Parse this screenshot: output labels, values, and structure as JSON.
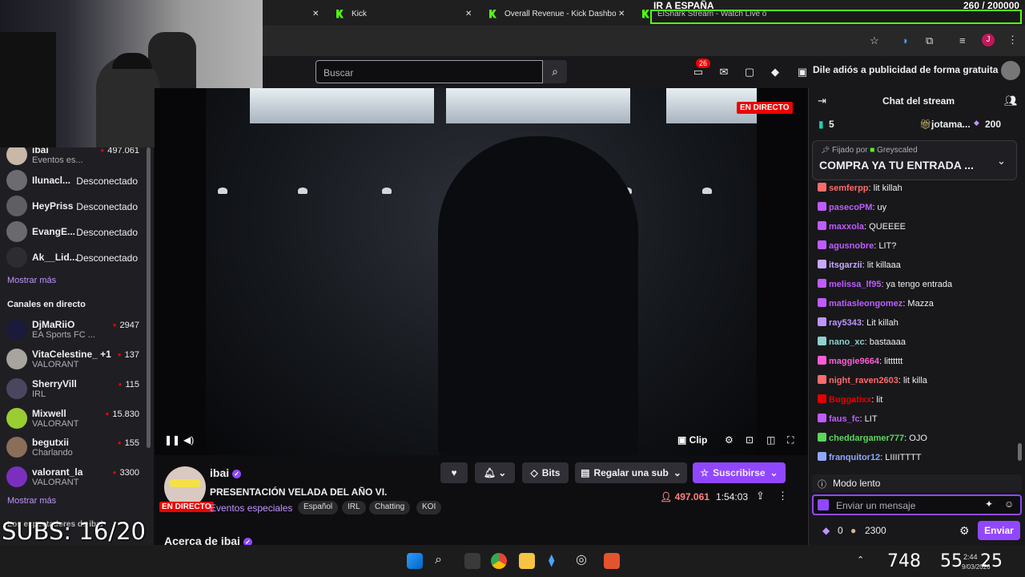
{
  "browser": {
    "tabs": [
      {
        "label": "Kick"
      },
      {
        "label": "Overall Revenue - Kick Dashbo"
      },
      {
        "label": "ElShark Stream - Watch Live o"
      }
    ]
  },
  "overlay": {
    "subs_counter": "SUBS: 16/20",
    "ir_label": "IR A ESPAÑA",
    "goal_counter": "260 / 200000"
  },
  "header": {
    "search_placeholder": "Buscar",
    "notifications_badge": "26",
    "adfree_label": "Dile adiós a publicidad de forma gratuita"
  },
  "sidebar": {
    "followed": [
      {
        "name": "ibai",
        "game": "Eventos es...",
        "count": "497.061"
      },
      {
        "name": "Ilunacl...",
        "status": "Desconectado"
      },
      {
        "name": "HeyPriss",
        "status": "Desconectado"
      },
      {
        "name": "EvangE...",
        "status": "Desconectado"
      },
      {
        "name": "Ak__Lid...",
        "status": "Desconectado"
      }
    ],
    "show_more_1": "Mostrar más",
    "live_heading": "Canales en directo",
    "live": [
      {
        "name": "DjMaRiiO",
        "game": "EA Sports FC ...",
        "count": "2947"
      },
      {
        "name": "VitaCelestine_ +1",
        "game": "VALORANT",
        "count": "137"
      },
      {
        "name": "SherryVill",
        "game": "IRL",
        "count": "115"
      },
      {
        "name": "Mixwell",
        "game": "VALORANT",
        "count": "15.830"
      },
      {
        "name": "begutxii",
        "game": "Charlando",
        "count": "155"
      },
      {
        "name": "valorant_la",
        "game": "VALORANT",
        "count": "3300"
      }
    ],
    "show_more_2": "Mostrar más",
    "bottom_partial": "Los espectadores de ibai"
  },
  "video": {
    "live_tag": "EN DIRECTO",
    "clip_label": "Clip"
  },
  "stream_info": {
    "channel": "ibai",
    "title": "PRESENTACIÓN VELADA DEL AÑO VI.",
    "category": "Eventos especiales",
    "live_tag": "EN DIRECTO",
    "tags": [
      "Español",
      "IRL",
      "Chatting",
      "KOI"
    ],
    "bits_label": "Bits",
    "gift_label": "Regalar una sub",
    "subscribe_label": "Suscribirse",
    "viewers": "497.061",
    "uptime": "1:54:03",
    "about": "Acerca de ibai"
  },
  "chat": {
    "title": "Chat del stream",
    "top_count": "5",
    "top_user": "jotama...",
    "top_user_count": "200",
    "pinned_by": "Fijado por",
    "pinned_by_user": "Greyscaled",
    "pinned_text": "COMPRA YA TU ENTRADA ...",
    "messages": [
      {
        "user": "semferpp",
        "text": ": lit killah",
        "color": "#ff6b6b"
      },
      {
        "user": "pasecoPM",
        "text": ": uy",
        "color": "#bf5cff"
      },
      {
        "user": "maxxola",
        "text": ": QUEEEE",
        "color": "#bf5cff"
      },
      {
        "user": "agusnobre",
        "text": ": LIT?",
        "color": "#bf5cff"
      },
      {
        "user": "itsgarzii",
        "text": ": lit killaaa",
        "color": "#c9a8ff"
      },
      {
        "user": "melissa_lf95",
        "text": ": ya tengo entrada",
        "color": "#bf5cff"
      },
      {
        "user": "matiasleongomez",
        "text": ": Mazza",
        "color": "#bf5cff"
      },
      {
        "user": "ray5343",
        "text": ": Lit killah",
        "color": "#bf94ff"
      },
      {
        "user": "nano_xc",
        "text": ": bastaaaa",
        "color": "#8fd0d0"
      },
      {
        "user": "maggie9664",
        "text": ": litttttt",
        "color": "#ff5cd6"
      },
      {
        "user": "night_raven2603",
        "text": ": lit killa",
        "color": "#ff6b6b"
      },
      {
        "user": "Buggatixx",
        "text": ": lit",
        "color": "#e00000"
      },
      {
        "user": "faus_fc",
        "text": ": LIT",
        "color": "#bf5cff"
      },
      {
        "user": "cheddargamer777",
        "text": ": OJO",
        "color": "#5cd65c"
      },
      {
        "user": "franquitor12",
        "text": ": LIIIITTTT",
        "color": "#8fa8ff"
      }
    ],
    "slow_mode": "Modo lento",
    "input_placeholder": "Enviar un mensaje",
    "points": "0",
    "points_2": "2300",
    "send_label": "Enviar"
  },
  "taskbar": {
    "time": "2:44",
    "date": "9/03/2026",
    "overlay_clock": [
      "748",
      "55",
      "25"
    ]
  }
}
